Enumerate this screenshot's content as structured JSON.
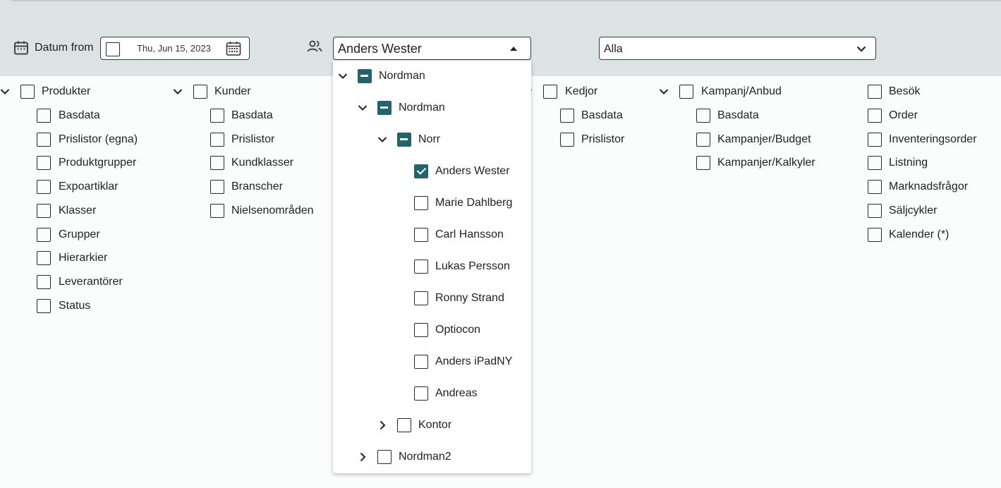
{
  "filters": {
    "date_label": "Datum from",
    "date_value": "Thu, Jun 15, 2023",
    "user_selected": "Anders Wester",
    "scope_selected": "Alla"
  },
  "columns": [
    {
      "title": "Produkter",
      "items": [
        "Basdata",
        "Prislistor (egna)",
        "Produktgrupper",
        "Expoartiklar",
        "Klasser",
        "Grupper",
        "Hierarkier",
        "Leverantörer",
        "Status"
      ]
    },
    {
      "title": "Kunder",
      "items": [
        "Basdata",
        "Prislistor",
        "Kundklasser",
        "Branscher",
        "Nielsenområden"
      ]
    },
    {
      "title": "Kedjor",
      "items": [
        "Basdata",
        "Prislistor"
      ]
    },
    {
      "title": "Kampanj/Anbud",
      "items": [
        "Basdata",
        "Kampanjer/Budget",
        "Kampanjer/Kalkyler"
      ]
    },
    {
      "title": "",
      "items": [
        "Besök",
        "Order",
        "Inventeringsorder",
        "Listning",
        "Marknadsfrågor",
        "Säljcykler",
        "Kalender (*)"
      ]
    }
  ],
  "tree": {
    "root": "Nordman",
    "group": "Nordman",
    "region": "Norr",
    "users": [
      "Anders Wester",
      "Marie Dahlberg",
      "Carl Hansson",
      "Lukas Persson",
      "Ronny Strand",
      "Optiocon",
      "Anders iPadNY",
      "Andreas"
    ],
    "collapsed_office": "Kontor",
    "collapsed_group": "Nordman2"
  },
  "icons": {
    "calendar": "calendar-icon",
    "people": "people-icon",
    "date_picker": "calendar-grid-icon",
    "caret_up": "caret-up-icon",
    "chevron_down": "chevron-down-icon",
    "chevron_right": "chevron-right-icon"
  },
  "colors": {
    "topbar": "#dce3e4",
    "accent": "#22646c",
    "background": "#fbfcfc"
  }
}
